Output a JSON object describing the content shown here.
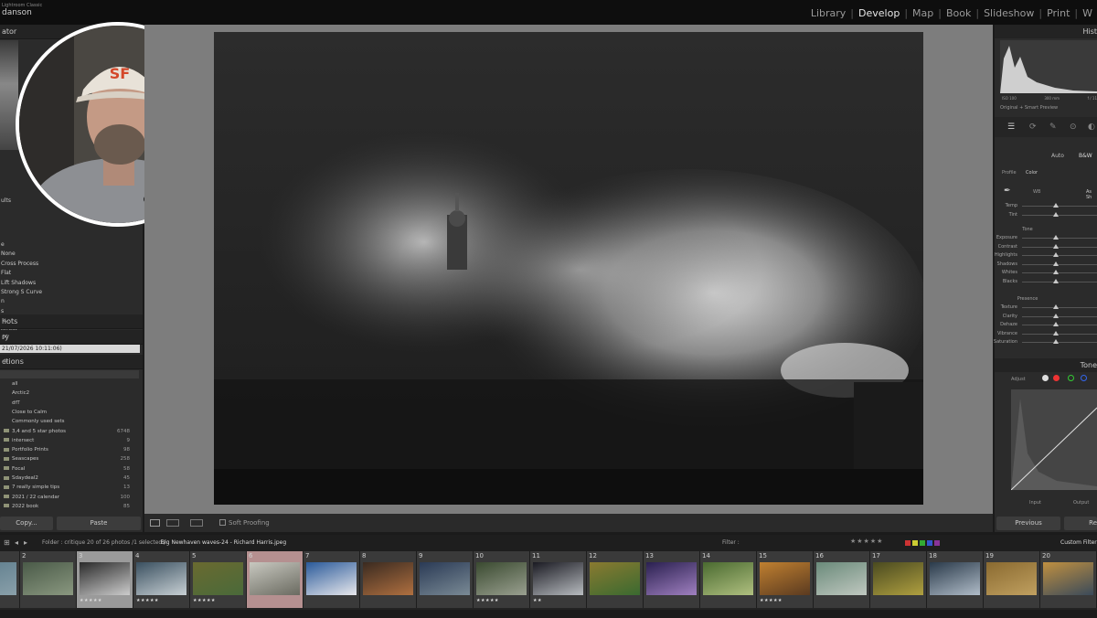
{
  "app": {
    "name": "Lightroom Classic",
    "user": "danson"
  },
  "modules": [
    {
      "label": "Library",
      "active": false
    },
    {
      "label": "Develop",
      "active": true
    },
    {
      "label": "Map",
      "active": false
    },
    {
      "label": "Book",
      "active": false
    },
    {
      "label": "Slideshow",
      "active": false
    },
    {
      "label": "Print",
      "active": false
    },
    {
      "label": "W",
      "active": false
    }
  ],
  "left_panel": {
    "navigator_title": "ator",
    "presets_label": "ults",
    "presets": [
      "e",
      "None",
      "Cross Process",
      "Flat",
      "Lift Shadows",
      "Strong S Curve",
      "n",
      "s",
      "pening",
      "etting"
    ],
    "snapshots_title": "hots",
    "history_title": "ry",
    "history_item": "21/07/2026 10:11:06)",
    "collections_title": "ctions",
    "collections": [
      {
        "name": "all",
        "count": ""
      },
      {
        "name": "Arctic2",
        "count": ""
      },
      {
        "name": "dfT",
        "count": ""
      },
      {
        "name": "Close to Calm",
        "count": ""
      },
      {
        "name": "Commonly used sets",
        "count": ""
      },
      {
        "name": "3,4 and 5 star photos",
        "count": "6748"
      },
      {
        "name": "intersect",
        "count": "9"
      },
      {
        "name": "Portfolio Prints",
        "count": "98"
      },
      {
        "name": "Seascapes",
        "count": "258"
      },
      {
        "name": "Focal",
        "count": "58"
      },
      {
        "name": "Sdaydeal2",
        "count": "45"
      },
      {
        "name": "7 really simple tips",
        "count": "13"
      },
      {
        "name": "2021 / 22 calendar",
        "count": "100"
      },
      {
        "name": "2022 book",
        "count": "85"
      }
    ],
    "copy_label": "Copy...",
    "paste_label": "Paste"
  },
  "toolbar": {
    "soft_proofing": "Soft Proofing"
  },
  "right_panel": {
    "histogram_title": "Hist",
    "histogram_info": [
      "ISO 100",
      "300 mm",
      "f / 11"
    ],
    "preview_label": "Original + Smart Preview",
    "auto_label": "Auto",
    "bw_label": "B&W",
    "profile_label": "Profile",
    "color_label": "Color",
    "wb_label": "WB",
    "wb_value": "As Sh",
    "tone_section": "Tone",
    "presence_section": "Presence",
    "sliders_wb": [
      {
        "label": "Temp",
        "pos": 0.45
      },
      {
        "label": "Tint",
        "pos": 0.45
      }
    ],
    "sliders_tone": [
      {
        "label": "Exposure",
        "pos": 0.45
      },
      {
        "label": "Contrast",
        "pos": 0.45
      },
      {
        "label": "Highlights",
        "pos": 0.45
      },
      {
        "label": "Shadows",
        "pos": 0.45
      },
      {
        "label": "Whites",
        "pos": 0.45
      },
      {
        "label": "Blacks",
        "pos": 0.45
      }
    ],
    "sliders_presence": [
      {
        "label": "Texture",
        "pos": 0.45
      },
      {
        "label": "Clarity",
        "pos": 0.45
      },
      {
        "label": "Dehaze",
        "pos": 0.45
      },
      {
        "label": "Vibrance",
        "pos": 0.45
      },
      {
        "label": "Saturation",
        "pos": 0.45
      }
    ],
    "tone_curve_title": "Tone",
    "adjust_label": "Adjust",
    "input_label": "Input",
    "output_label": "Output",
    "previous_label": "Previous",
    "reset_label": "Re"
  },
  "bottom_bar": {
    "path": "Folder : critique   20 of 26 photos /1 selected /",
    "filename": "Big Newhaven waves-24 - Richard Harris.jpeg",
    "filter_label": "Filter :",
    "custom_filter": "Custom Filter"
  },
  "filmstrip": [
    {
      "num": "",
      "stars": "",
      "colors": [
        "#5a7a8a",
        "#8aa0aa"
      ]
    },
    {
      "num": "2",
      "stars": "",
      "colors": [
        "#4a5a48",
        "#8a9880"
      ]
    },
    {
      "num": "3",
      "stars": "★★★★★",
      "colors": [
        "#2a2a2a",
        "#cccccc"
      ]
    },
    {
      "num": "4",
      "stars": "★★★★★",
      "colors": [
        "#3a5060",
        "#c8d0d4"
      ]
    },
    {
      "num": "5",
      "stars": "★★★★★",
      "colors": [
        "#6a6a30",
        "#4a6a3a"
      ]
    },
    {
      "num": "6",
      "stars": "",
      "colors": [
        "#c8c8c0",
        "#6a6a60"
      ]
    },
    {
      "num": "7",
      "stars": "",
      "colors": [
        "#2a5a9a",
        "#e8e8ec"
      ]
    },
    {
      "num": "8",
      "stars": "",
      "colors": [
        "#3a2a20",
        "#b07040"
      ]
    },
    {
      "num": "9",
      "stars": "",
      "colors": [
        "#2a3a55",
        "#7a8a95"
      ]
    },
    {
      "num": "10",
      "stars": "★★★★★",
      "colors": [
        "#3a4a30",
        "#9aa090"
      ]
    },
    {
      "num": "11",
      "stars": "★★",
      "colors": [
        "#1a1a22",
        "#b8bcc0"
      ]
    },
    {
      "num": "12",
      "stars": "",
      "colors": [
        "#8a7a30",
        "#3a6a30"
      ]
    },
    {
      "num": "13",
      "stars": "",
      "colors": [
        "#2a2050",
        "#a080c0"
      ]
    },
    {
      "num": "14",
      "stars": "",
      "colors": [
        "#4a6a30",
        "#b0c080"
      ]
    },
    {
      "num": "15",
      "stars": "★★★★★",
      "colors": [
        "#c08030",
        "#5a3a20"
      ]
    },
    {
      "num": "16",
      "stars": "",
      "colors": [
        "#6a8a7a",
        "#c0c8c0"
      ]
    },
    {
      "num": "17",
      "stars": "",
      "colors": [
        "#4a4a20",
        "#b0a040"
      ]
    },
    {
      "num": "18",
      "stars": "",
      "colors": [
        "#2a3a4a",
        "#b0bcc8"
      ]
    },
    {
      "num": "19",
      "stars": "",
      "colors": [
        "#8a6a30",
        "#c0a060"
      ]
    },
    {
      "num": "20",
      "stars": "",
      "colors": [
        "#c09040",
        "#3a4a5a"
      ]
    }
  ]
}
